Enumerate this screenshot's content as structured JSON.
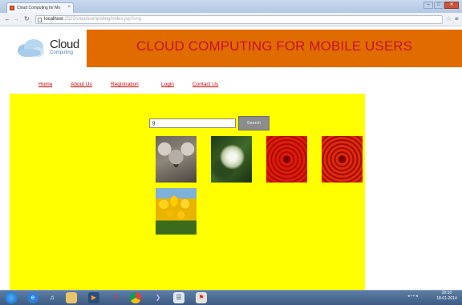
{
  "browser": {
    "tab_title": "Cloud Computing for Mo",
    "tab_close": "×",
    "url_host": "localhost",
    "url_rest": ":2525/cloudcomputing/index.jsp?s=g",
    "window_controls": [
      "–",
      "□",
      "✕"
    ]
  },
  "header": {
    "logo_word": "Cloud",
    "logo_sub": "Computing",
    "banner_title": "CLOUD COMPUTING FOR MOBILE USERS"
  },
  "nav": [
    "Home",
    "About Us",
    "Registration",
    "Login",
    "Contact Us"
  ],
  "search": {
    "value": "g",
    "button_label": "Search"
  },
  "results": [
    {
      "kind": "koala-photo"
    },
    {
      "kind": "white-flower-photo"
    },
    {
      "kind": "red-chrysanthemum-photo"
    },
    {
      "kind": "red-chrysanthemum-photo"
    },
    {
      "kind": "yellow-tulips-photo"
    }
  ],
  "taskbar": {
    "clock_time": "20:10",
    "clock_date": "18-01-2014"
  },
  "colors": {
    "banner": "#e06c00",
    "banner_title": "#c8102e",
    "panel": "#ffff00",
    "nav_link": "#cc0000",
    "search_button": "#8c8c8c"
  }
}
